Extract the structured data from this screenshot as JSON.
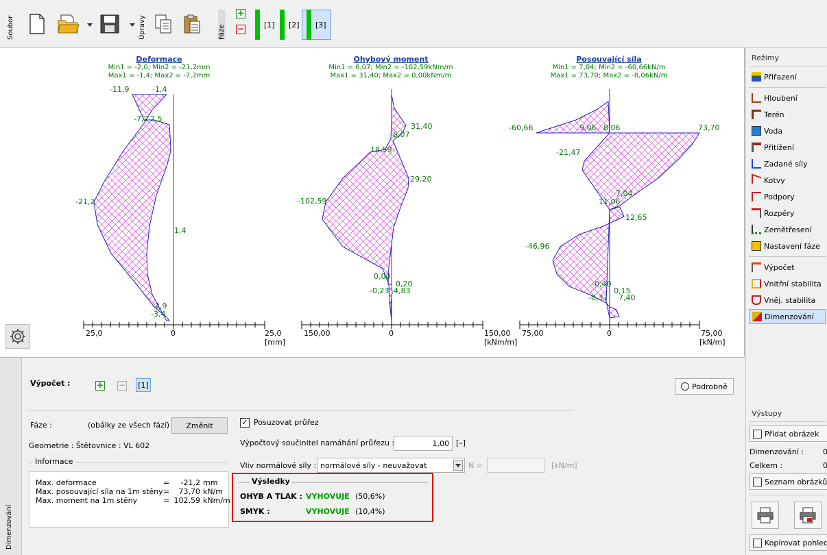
{
  "toolbar": {
    "soubor_label": "Soubor",
    "upravy_label": "Úpravy",
    "faze_label": "Fáze",
    "phases": [
      {
        "label": "[1]",
        "selected": false
      },
      {
        "label": "[2]",
        "selected": false
      },
      {
        "label": "[3]",
        "selected": true
      }
    ]
  },
  "graphs": {
    "deformace": {
      "title": "Deformace",
      "line1": "Min1 = -2,0; Min2 = -21,2mm",
      "line2": "Max1 = -1,4; Max2 = -7,2mm",
      "labels": [
        "-11,9",
        "-1,4",
        "-7,2",
        "2,5",
        "-21,2",
        "1,4",
        "-2,9",
        "-3,4"
      ],
      "axis_min": "25,0",
      "axis_zero": "0",
      "axis_max": "25,0",
      "unit": "[mm]"
    },
    "moment": {
      "title": "Ohybový moment",
      "line1": "Min1 = 6,07; Min2 = -102,59kNm/m",
      "line2": "Max1 = 31,40; Max2 = 0,00kNm/m",
      "labels": [
        "31,40",
        "6,07",
        "18,59",
        "29,20",
        "-102,59",
        "0,00",
        "0,20",
        "-0,23",
        "4,83"
      ],
      "axis_min": "150,00",
      "axis_zero": "0",
      "axis_max": "150,00",
      "unit": "[kNm/m]"
    },
    "shear": {
      "title": "Posouvající síla",
      "line1": "Min1 = 7,04; Min2 = -60,66kN/m",
      "line2": "Max1 = 73,70; Max2 = -8,06kN/m",
      "labels": [
        "-60,66",
        "9,06",
        "8,06",
        "73,70",
        "-21,47",
        "7,04",
        "11,06",
        "12,65",
        "-46,96",
        "-0,40",
        "0,15",
        "-0,37",
        "7,40"
      ],
      "axis_min": "75,00",
      "axis_zero": "0",
      "axis_max": "75,00",
      "unit": "[kN/m]"
    }
  },
  "right_panel": {
    "rezimy_title": "Režimy",
    "items": [
      {
        "label": "Přiřazení",
        "icon": "assign-icon"
      },
      {
        "label": "Hloubení",
        "icon": "excavation-icon"
      },
      {
        "label": "Terén",
        "icon": "terrain-icon"
      },
      {
        "label": "Voda",
        "icon": "water-icon"
      },
      {
        "label": "Přitížení",
        "icon": "surcharge-icon"
      },
      {
        "label": "Zadané síly",
        "icon": "forces-icon"
      },
      {
        "label": "Kotvy",
        "icon": "anchors-icon"
      },
      {
        "label": "Podpory",
        "icon": "supports-icon"
      },
      {
        "label": "Rozpěry",
        "icon": "props-icon"
      },
      {
        "label": "Zemětřesení",
        "icon": "earthquake-icon"
      },
      {
        "label": "Nastavení fáze",
        "icon": "phase-settings-icon"
      },
      {
        "label": "Výpočet",
        "icon": "analysis-icon"
      },
      {
        "label": "Vnitřní stabilita",
        "icon": "internal-stability-icon"
      },
      {
        "label": "Vněj. stabilita",
        "icon": "external-stability-icon"
      },
      {
        "label": "Dimenzování",
        "icon": "design-icon",
        "selected": true
      }
    ],
    "vystupy_title": "Výstupy",
    "add_picture": "Přidat obrázek",
    "dim_label": "Dimenzování :",
    "dim_value": "0",
    "celkem_label": "Celkem :",
    "celkem_value": "0",
    "list_pictures": "Seznam obrázků",
    "copy_view": "Kopírovat pohled"
  },
  "bottom": {
    "tab_label": "Dimenzování",
    "vypocet_label": "Výpočet :",
    "vypocet_item": "[1]",
    "podrobne_label": "Podrobně",
    "faze_label": "Fáze :",
    "faze_value": "(obálky ze všech fází)",
    "zmenit_label": "Změnit",
    "geometrie": "Geometrie : Štětovnice : VL 602",
    "informace_title": "Informace",
    "info_rows": [
      {
        "name": "Max. deformace",
        "eq": "=",
        "value": "-21,2",
        "unit": "mm"
      },
      {
        "name": "Max. posouvající síla na 1m stěny",
        "eq": "=",
        "value": "73,70",
        "unit": "kN/m"
      },
      {
        "name": "Max. moment na 1m stěny",
        "eq": "=",
        "value": "102,59",
        "unit": "kNm/m"
      }
    ],
    "posuzovat_label": "Posuzovat průřez",
    "posuzovat_checked": true,
    "soucinitel_label": "Výpočtový součinitel namáhání průřezu :",
    "soucinitel_value": "1,00",
    "soucinitel_unit": "[–]",
    "vliv_label": "Vliv normálové síly :",
    "vliv_value": "normálové síly - neuvažovat",
    "n_label": "N =",
    "n_unit": "[kN/m]",
    "vysledky_title": "Výsledky",
    "ohyb_label": "OHYB A TLAK :",
    "ohyb_status": "VYHOVUJE",
    "ohyb_pct": "(50,6%)",
    "smyk_label": "SMYK :",
    "smyk_status": "VYHOVUJE",
    "smyk_pct": "(10,4%)",
    "highlight_color": "#e00000"
  }
}
